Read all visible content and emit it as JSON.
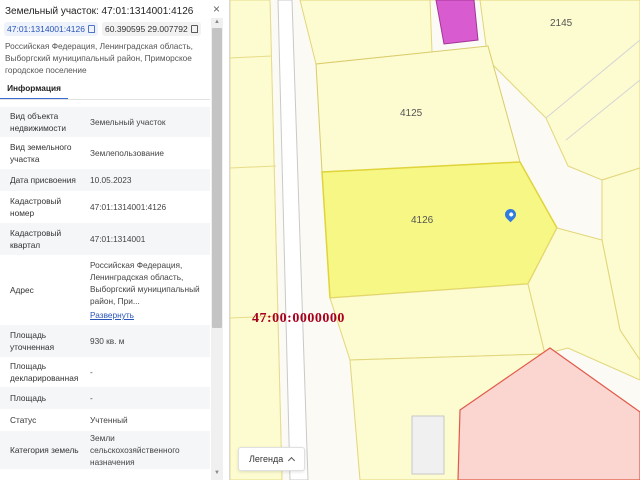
{
  "panel": {
    "title": "Земельный участок: 47:01:1314001:4126",
    "close_glyph": "×",
    "cadastral_chip": "47:01:1314001:4126",
    "coords_chip": "60.390595 29.007792",
    "address": "Российская Федерация, Ленинградская область, Выборгский муниципальный район, Приморское городское поселение",
    "tab_label": "Информация",
    "rows": [
      {
        "key": "Вид объекта недвижимости",
        "value": "Земельный участок"
      },
      {
        "key": "Вид земельного участка",
        "value": "Землепользование"
      },
      {
        "key": "Дата присвоения",
        "value": "10.05.2023"
      },
      {
        "key": "Кадастровый номер",
        "value": "47:01:1314001:4126"
      },
      {
        "key": "Кадастровый квартал",
        "value": "47:01:1314001"
      },
      {
        "key": "Адрес",
        "value": "Российская Федерация, Ленинградская область, Выборгский муниципальный район, При...",
        "link": "Развернуть"
      },
      {
        "key": "Площадь уточненная",
        "value": "930 кв. м"
      },
      {
        "key": "Площадь декларированная",
        "value": "-"
      },
      {
        "key": "Площадь",
        "value": "-"
      },
      {
        "key": "Статус",
        "value": "Учтенный"
      },
      {
        "key": "Категория земель",
        "value": "Земли сельскохозяйственного назначения"
      }
    ]
  },
  "map": {
    "plot_labels": {
      "p2145": "2145",
      "p4125": "4125",
      "p4126": "4126"
    },
    "quarter_label": "47:00:0000000",
    "legend_label": "Легенда"
  },
  "colors": {
    "selected_plot": "#f7f785",
    "plot_fill": "#fdfbd0",
    "highlight_plot": "#d85bd0",
    "red_zone": "#fbd5d0",
    "link": "#2a55b8"
  }
}
